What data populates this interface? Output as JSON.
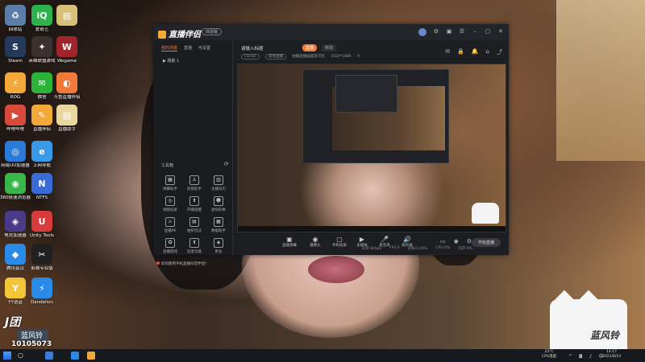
{
  "desktop": {
    "icons": [
      {
        "label": "回收站",
        "color": "#5a7ea8",
        "glyph": "♻"
      },
      {
        "label": "爱奇艺",
        "color": "#2db34a",
        "glyph": "iQ"
      },
      {
        "label": "",
        "color": "#d8c07a",
        "glyph": "▤"
      },
      {
        "label": "Steam",
        "color": "#233a5a",
        "glyph": "S"
      },
      {
        "label": "英雄联盟游戏",
        "color": "#3a3030",
        "glyph": "✦"
      },
      {
        "label": "Wegame",
        "color": "#a0242a",
        "glyph": "W"
      },
      {
        "label": "ROG",
        "color": "#f3a83a",
        "glyph": "⚡"
      },
      {
        "label": "微信",
        "color": "#2bb33a",
        "glyph": "✉"
      },
      {
        "label": "斗鱼直播伴侣",
        "color": "#f17a3a",
        "glyph": "◐"
      },
      {
        "label": "哔哩哔哩",
        "color": "#d84a3a",
        "glyph": "▶"
      },
      {
        "label": "直播伴侣",
        "color": "#f3a83a",
        "glyph": "✎"
      },
      {
        "label": "直播助手",
        "color": "#e8d8a0",
        "glyph": "▤"
      },
      {
        "label": "网易UU加速器",
        "color": "#2a7ad8",
        "glyph": "◎"
      },
      {
        "label": "上网导航",
        "color": "#3a9ae8",
        "glyph": "e"
      },
      {
        "label": "360极速浏览器",
        "color": "#3ab54a",
        "glyph": "◉"
      },
      {
        "label": "NTFS",
        "color": "#3a6ad8",
        "glyph": "N"
      },
      {
        "label": "电竞加速器",
        "color": "#4a3a8a",
        "glyph": "◈"
      },
      {
        "label": "Unity Tools",
        "color": "#d83a3a",
        "glyph": "U"
      },
      {
        "label": "腾讯会议",
        "color": "#2a8ae8",
        "glyph": "◆"
      },
      {
        "label": "剪映专业版",
        "color": "#202020",
        "glyph": "✂"
      },
      {
        "label": "YY语音",
        "color": "#f3c63a",
        "glyph": "Y"
      },
      {
        "label": "Dandelion",
        "color": "#2a8ae8",
        "glyph": "⚡"
      }
    ]
  },
  "app": {
    "title": "直播伴侣",
    "version_tag": "体验版",
    "titlebar_icons": [
      "avatar",
      "gear-icon",
      "skin-icon",
      "menu-icon",
      "minimize-icon",
      "maximize-icon",
      "close-icon"
    ],
    "left_tabs": [
      "我的场景",
      "直播",
      "可设置"
    ],
    "scene_name": "▶ 场景 1",
    "toolbox_title": "工具箱",
    "tools": [
      {
        "label": "弹幕助手",
        "glyph": "▦"
      },
      {
        "label": "房管助手",
        "glyph": "♙"
      },
      {
        "label": "主播日历",
        "glyph": "▥"
      },
      {
        "label": "视频投屏",
        "glyph": "◎"
      },
      {
        "label": "开播提醒",
        "glyph": "⬆"
      },
      {
        "label": "虚拟形象",
        "glyph": "☻"
      },
      {
        "label": "直播PK",
        "glyph": "⚔"
      },
      {
        "label": "抽奖玩法",
        "glyph": "▤"
      },
      {
        "label": "数据助手",
        "glyph": "▦"
      },
      {
        "label": "直播游戏",
        "glyph": "✪"
      },
      {
        "label": "连麦功能",
        "glyph": "⬆"
      },
      {
        "label": "更多",
        "glyph": "◈"
      }
    ],
    "notice": "如何使用手机直播抖音伴侣？",
    "room_title": "请输入标题",
    "live_tag": "直播",
    "edit_tag": "修改",
    "room_sub": [
      "CS:GO",
      "游戏直播",
      "拍摄直播画面及可见",
      "1920*1080",
      "0"
    ],
    "bottom_tools": [
      {
        "label": "直播弹幕",
        "glyph": "▣"
      },
      {
        "label": "摄像头",
        "glyph": "◉"
      },
      {
        "label": "手机投屏",
        "glyph": "▢"
      },
      {
        "label": "多媒体",
        "glyph": "▶"
      },
      {
        "label": "麦克风",
        "glyph": "🎤"
      },
      {
        "label": "扬声器",
        "glyph": "🔊"
      }
    ],
    "start_label": "开始直播",
    "status": [
      "码率:0kbps",
      "FPS:0",
      "丢帧:0.00%",
      "CPU:0%",
      "内存:0%"
    ]
  },
  "overlay": {
    "badge_line1": "J团",
    "badge_line2": "蓝风铃",
    "room_id": "10105073",
    "cat_text": "蓝风铃"
  },
  "taskbar": {
    "weather": "23°C",
    "weather_desc": "CPU温度",
    "time": "14:17",
    "date": "2021/8/14"
  }
}
